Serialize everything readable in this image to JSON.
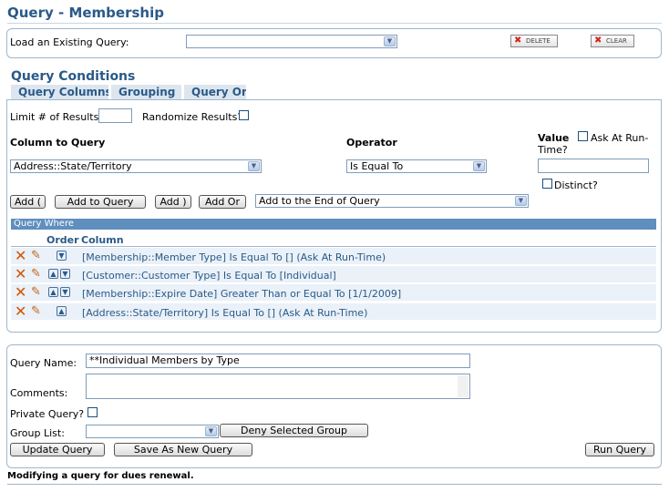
{
  "page_title": "Query - Membership",
  "load_query": {
    "label": "Load an Existing Query:",
    "value": ""
  },
  "toolbar": {
    "delete_label": "DELETE",
    "clear_label": "CLEAR"
  },
  "conditions": {
    "title": "Query Conditions",
    "tabs": [
      "Query Columns",
      "Grouping",
      "Query Ord"
    ],
    "limit_label": "Limit # of Results:",
    "limit_value": "",
    "randomize_label": "Randomize Results?",
    "column_header": "Column to Query",
    "operator_header": "Operator",
    "value_header": "Value",
    "ask_runtime_label": "Ask At Run-",
    "ask_runtime_label2": "Time?",
    "column_value": "Address::State/Territory",
    "operator_value": "Is Equal To",
    "value_value": "",
    "distinct_label": "Distinct?",
    "buttons": {
      "add_open": "Add (",
      "add_to_query": "Add to Query",
      "add_close": "Add )",
      "add_or": "Add Or"
    },
    "position_value": "Add to the End of Query"
  },
  "query_where": {
    "title": "Query Where",
    "col_order": "Order",
    "col_column": "Column",
    "rows": [
      {
        "text": "[Membership::Member Type] Is Equal To [] (Ask At Run-Time)"
      },
      {
        "text": "[Customer::Customer Type] Is Equal To [Individual]"
      },
      {
        "text": "[Membership::Expire Date] Greater Than or Equal To [1/1/2009]"
      },
      {
        "text": "[Address::State/Territory] Is Equal To [] (Ask At Run-Time)"
      }
    ]
  },
  "save": {
    "name_label": "Query Name:",
    "name_value": "**Individual Members by Type",
    "comments_label": "Comments:",
    "comments_value": "",
    "private_label": "Private Query?",
    "group_label": "Group List:",
    "group_value": "",
    "deny_label": "Deny Selected Group",
    "update_label": "Update Query",
    "save_new_label": "Save As New Query",
    "run_label": "Run Query"
  },
  "footer_text": "Modifying a query for dues renewal.",
  "colors": {
    "accent": "#2a5a88",
    "header_bar": "#5f8fbe",
    "row_bg": "#eaf1f8",
    "delete_icon": "#d35400"
  },
  "icons": [
    "delete-x-icon",
    "edit-pencil-icon",
    "move-up-icon",
    "move-down-icon",
    "dropdown-arrow-icon"
  ]
}
